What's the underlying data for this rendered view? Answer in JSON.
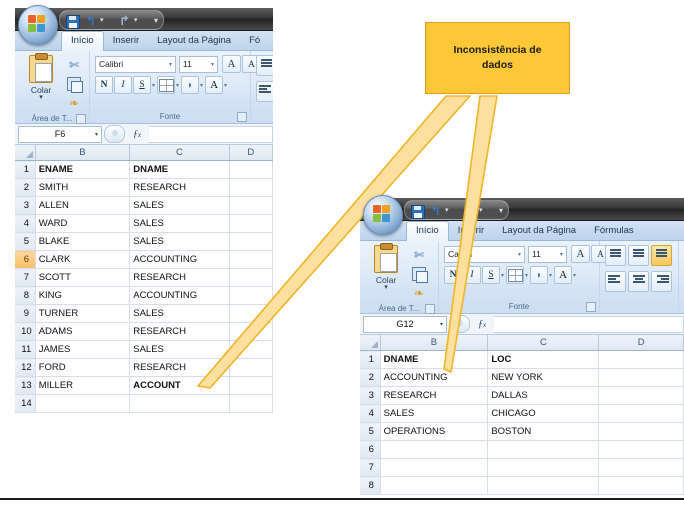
{
  "callout": {
    "text_line1": "Inconsistência de",
    "text_line2": "dados",
    "fill_color": "#fcc838",
    "border_color": "#e09f1c",
    "arrow_fill": "#fde0a0",
    "arrow_stroke": "#f0b429"
  },
  "window1": {
    "name": "excel-window-employees",
    "quick_access": {
      "save": "save-icon",
      "undo": "undo-icon",
      "redo": "redo-icon",
      "customize": "chevron-down-icon"
    },
    "office_button": "office-orb",
    "tabs": [
      {
        "label": "Início",
        "active": true
      },
      {
        "label": "Inserir",
        "active": false
      },
      {
        "label": "Layout da Página",
        "active": false
      },
      {
        "label": "Fó",
        "active": false
      }
    ],
    "ribbon": {
      "clipboard_group": {
        "label": "Área de T...",
        "paste_label": "Colar",
        "icons": [
          "clipboard-icon",
          "scissors-icon",
          "copy-icon",
          "format-painter-icon"
        ]
      },
      "font_group": {
        "label": "Fonte",
        "font_name": "Calibri",
        "font_size": "11",
        "grow_font": "A",
        "shrink_font": "A",
        "bold": "N",
        "italic": "I",
        "underline": "S",
        "borders": "borders-icon",
        "fill_color": "fill-color-icon",
        "font_color": "A"
      }
    },
    "formula_bar": {
      "name_box": "F6",
      "fx_label": "fx",
      "formula_value": ""
    },
    "grid": {
      "column_headers": [
        "B",
        "C",
        "D"
      ],
      "selected_row": 6,
      "rows": [
        {
          "num": "1",
          "B": "ENAME",
          "C": "DNAME",
          "bold": true
        },
        {
          "num": "2",
          "B": "SMITH",
          "C": "RESEARCH",
          "bold": false
        },
        {
          "num": "3",
          "B": "ALLEN",
          "C": "SALES",
          "bold": false
        },
        {
          "num": "4",
          "B": "WARD",
          "C": "SALES",
          "bold": false
        },
        {
          "num": "5",
          "B": "BLAKE",
          "C": "SALES",
          "bold": false
        },
        {
          "num": "6",
          "B": "CLARK",
          "C": "ACCOUNTING",
          "bold": false
        },
        {
          "num": "7",
          "B": "SCOTT",
          "C": "RESEARCH",
          "bold": false
        },
        {
          "num": "8",
          "B": "KING",
          "C": "ACCOUNTING",
          "bold": false
        },
        {
          "num": "9",
          "B": "TURNER",
          "C": "SALES",
          "bold": false
        },
        {
          "num": "10",
          "B": "ADAMS",
          "C": "RESEARCH",
          "bold": false
        },
        {
          "num": "11",
          "B": "JAMES",
          "C": "SALES",
          "bold": false
        },
        {
          "num": "12",
          "B": "FORD",
          "C": "RESEARCH",
          "bold": false
        },
        {
          "num": "13",
          "B": "MILLER",
          "C": "ACCOUNT",
          "bold": false,
          "error": true
        },
        {
          "num": "14",
          "B": "",
          "C": "",
          "bold": false
        }
      ]
    }
  },
  "window2": {
    "name": "excel-window-departments",
    "quick_access": {
      "save": "save-icon",
      "undo": "undo-icon",
      "redo": "redo-icon",
      "customize": "chevron-down-icon"
    },
    "office_button": "office-orb",
    "tabs": [
      {
        "label": "Início",
        "active": true
      },
      {
        "label": "Inserir",
        "active": false
      },
      {
        "label": "Layout da Página",
        "active": false
      },
      {
        "label": "Fórmulas",
        "active": false
      }
    ],
    "ribbon": {
      "clipboard_group": {
        "label": "Área de T...",
        "paste_label": "Colar",
        "icons": [
          "clipboard-icon",
          "scissors-icon",
          "copy-icon",
          "format-painter-icon"
        ]
      },
      "font_group": {
        "label": "Fonte",
        "font_name": "Calibri",
        "font_size": "11",
        "grow_font": "A",
        "shrink_font": "A",
        "bold": "N",
        "italic": "I",
        "underline": "S",
        "borders": "borders-icon",
        "fill_color": "fill-color-icon",
        "font_color": "A"
      },
      "alignment_group": {
        "label": ""
      }
    },
    "formula_bar": {
      "name_box": "G12",
      "fx_label": "fx",
      "formula_value": ""
    },
    "grid": {
      "column_headers": [
        "B",
        "C",
        "D"
      ],
      "rows": [
        {
          "num": "1",
          "B": "DNAME",
          "C": "LOC",
          "bold": true
        },
        {
          "num": "2",
          "B": "ACCOUNTING",
          "C": "NEW YORK",
          "bold": false
        },
        {
          "num": "3",
          "B": "RESEARCH",
          "C": "DALLAS",
          "bold": false
        },
        {
          "num": "4",
          "B": "SALES",
          "C": "CHICAGO",
          "bold": false
        },
        {
          "num": "5",
          "B": "OPERATIONS",
          "C": "BOSTON",
          "bold": false
        },
        {
          "num": "6",
          "B": "",
          "C": "",
          "bold": false
        },
        {
          "num": "7",
          "B": "",
          "C": "",
          "bold": false
        },
        {
          "num": "8",
          "B": "",
          "C": "",
          "bold": false
        }
      ]
    }
  }
}
